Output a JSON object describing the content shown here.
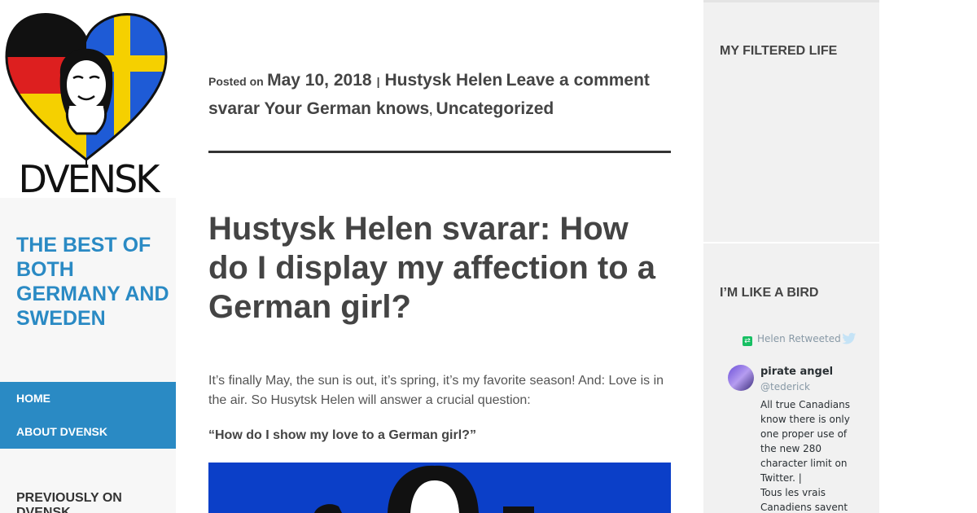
{
  "site": {
    "logo_text": "DVENSK",
    "title": "THE BEST OF BOTH GERMANY AND SWEDEN"
  },
  "nav": {
    "items": [
      {
        "label": "HOME"
      },
      {
        "label": "ABOUT DVENSK"
      }
    ]
  },
  "left_widget": {
    "title": "PREVIOUSLY ON DVENSK"
  },
  "post": {
    "posted_on": "Posted on",
    "date": "May 10, 2018",
    "author": "Hustysk Helen",
    "comment_link": "Leave a comment",
    "tags": "svarar Your German knows",
    "category": "Uncategorized",
    "title": "Hustysk Helen svarar: How do I display my affection to a German girl?",
    "intro": "It’s finally May,  the sun is out, it’s spring, it’s my favorite season! And: Love is in the air. So Husytsk Helen will answer a crucial question:",
    "question": "“How do I show my love to a German girl?”"
  },
  "right_sidebar": {
    "widget1_title": "MY FILTERED LIFE",
    "widget2_title": "I’M LIKE A BIRD",
    "tweet": {
      "retweet_label": "Helen Retweeted",
      "author_name": "pirate angel",
      "author_handle": "@tederick",
      "text_line1": "All true Canadians know there is only one proper use of the new 280 character limit on Twitter. |",
      "text_line2": "Tous les vrais Canadiens savent"
    }
  },
  "colors": {
    "accent": "#2a8ac4",
    "image_blue": "#0b3fc8",
    "retweet_green": "#17bf63",
    "twitter_gray": "#8899a6"
  },
  "icons": [
    "heart-flag-logo-icon",
    "retweet-icon",
    "twitter-bird-icon"
  ]
}
